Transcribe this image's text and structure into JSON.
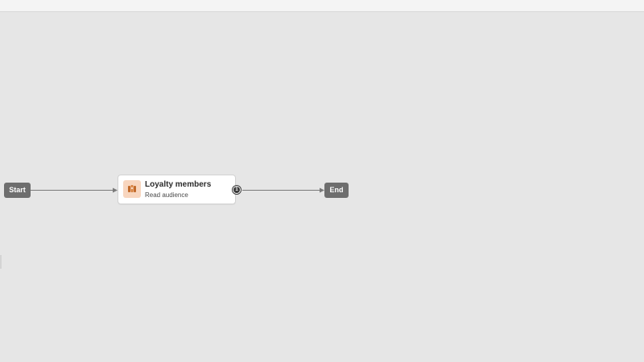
{
  "workflow": {
    "start_label": "Start",
    "end_label": "End",
    "activity": {
      "title": "Loyalty members",
      "subtitle": "Read audience",
      "icon": "audience-icon",
      "icon_color": "#f8d6bf",
      "output_port_label": "1"
    }
  },
  "colors": {
    "canvas": "#e6e6e6",
    "pill": "#6e6e6e",
    "connector": "#7a7a7a"
  }
}
